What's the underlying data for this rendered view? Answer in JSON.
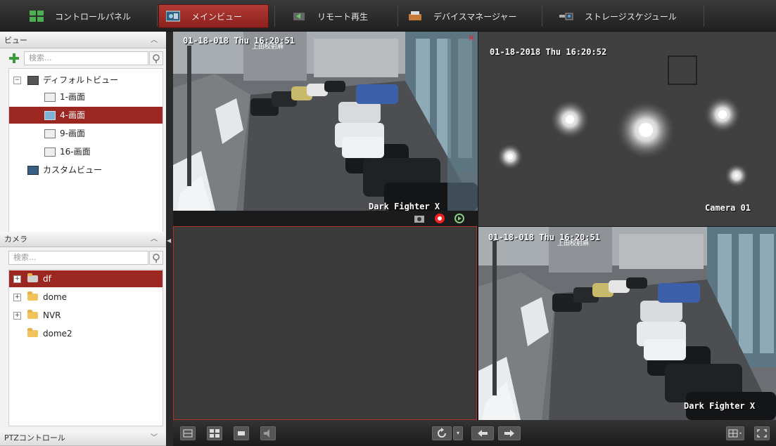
{
  "tabs": [
    {
      "label": "コントロールパネル",
      "active": false,
      "icon": "control-panel-icon"
    },
    {
      "label": "メインビュー",
      "active": true,
      "icon": "main-view-icon"
    },
    {
      "label": "リモート再生",
      "active": false,
      "icon": "remote-playback-icon"
    },
    {
      "label": "デバイスマネージャー",
      "active": false,
      "icon": "device-manager-icon"
    },
    {
      "label": "ストレージスケジュール",
      "active": false,
      "icon": "storage-schedule-icon"
    }
  ],
  "view_panel": {
    "title": "ビュー",
    "search_placeholder": "検索...",
    "tree": {
      "default_view": "ディフォルトビュー",
      "items": [
        "1-画面",
        "4-画面",
        "9-画面",
        "16-画面"
      ],
      "selected": "4-画面",
      "custom_view": "カスタムビュー"
    }
  },
  "camera_panel": {
    "title": "カメラ",
    "search_placeholder": "検索...",
    "items": [
      "df",
      "dome",
      "NVR",
      "dome2"
    ],
    "selected": "df"
  },
  "ptz_panel": {
    "title": "PTZコントロール"
  },
  "video": {
    "cell1": {
      "timestamp": "01-18-018 Thu 16:20:51",
      "label": "Dark Fighter X",
      "sign": "上田校射麻"
    },
    "cell2": {
      "timestamp": "01-18-2018 Thu 16:20:52",
      "label": "Camera 01"
    },
    "cell4": {
      "timestamp": "01-18-018 Thu 16:20:51",
      "label": "Dark Fighter X",
      "sign": "上田校射麻"
    }
  },
  "colors": {
    "accent": "#9c2620",
    "active_tab": "#a22c27"
  }
}
